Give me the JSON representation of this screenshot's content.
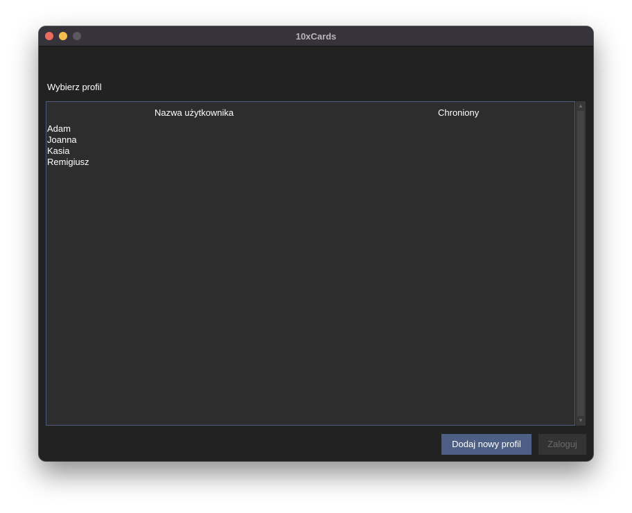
{
  "window": {
    "title": "10xCards"
  },
  "main": {
    "label": "Wybierz profil",
    "table": {
      "columns": [
        "Nazwa użytkownika",
        "Chroniony"
      ],
      "rows": [
        {
          "name": "Adam",
          "protected": ""
        },
        {
          "name": "Joanna",
          "protected": ""
        },
        {
          "name": "Kasia",
          "protected": ""
        },
        {
          "name": "Remigiusz",
          "protected": ""
        }
      ]
    }
  },
  "buttons": {
    "add_profile": "Dodaj nowy profil",
    "login": "Zaloguj"
  },
  "icons": {
    "close": "close-icon",
    "minimize": "minimize-icon",
    "maximize": "maximize-icon",
    "scroll_up": "scroll-up-icon",
    "scroll_down": "scroll-down-icon"
  },
  "colors": {
    "accent": "#4d5f84",
    "window_bg": "#222222",
    "table_bg": "#2d2d2d",
    "table_border": "#4a5c80"
  }
}
